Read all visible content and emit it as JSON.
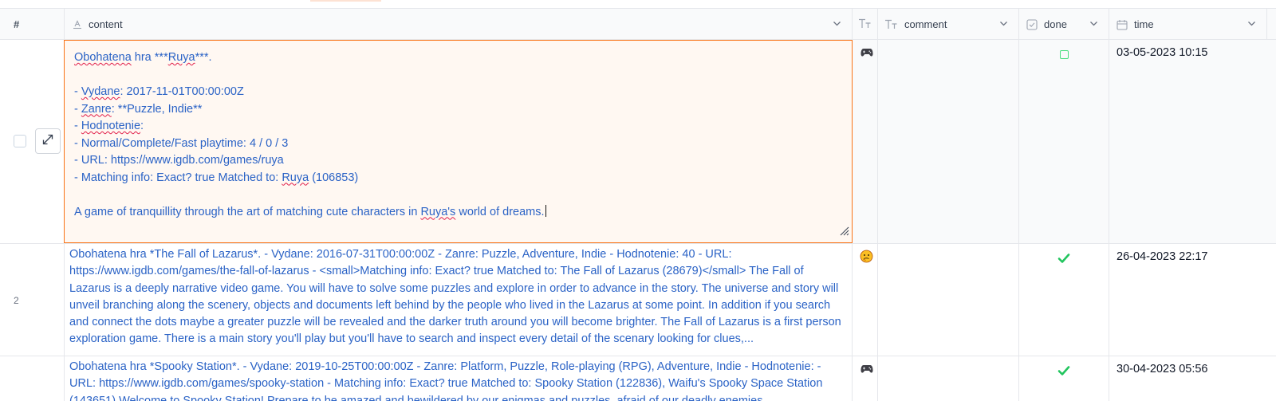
{
  "header": {
    "rownum": "#",
    "content": "content",
    "comment": "comment",
    "done": "done",
    "time": "time"
  },
  "rows": [
    {
      "number": "",
      "editor_lines": [
        "Obohatena hra ***Ruya***.",
        "",
        "- Vydane: 2017-11-01T00:00:00Z",
        "- Zanre: **Puzzle, Indie**",
        "- Hodnotenie:",
        "- Normal/Complete/Fast playtime: 4 / 0 / 3",
        "- URL: https://www.igdb.com/games/ruya",
        "- Matching info: Exact? true Matched to: Ruya (106853)",
        "",
        "A game of tranquillity through the art of matching cute characters in Ruya's world of dreams."
      ],
      "type_icon": "gamepad-icon",
      "comment": "",
      "done": false,
      "time": "03-05-2023 10:15"
    },
    {
      "number": "2",
      "content": "Obohatena hra *The Fall of Lazarus*. - Vydane: 2016-07-31T00:00:00Z - Zanre: Puzzle, Adventure, Indie - Hodnotenie: 40 - URL: https://www.igdb.com/games/the-fall-of-lazarus - <small>Matching info: Exact? true Matched to: The Fall of Lazarus (28679)</small> The Fall of Lazarus is a deeply narrative video game. You will have to solve some puzzles and explore in order to advance in the story. The universe and story will unveil branching along the scenery, objects and documents left behind by the people who lived in the Lazarus at some point. In addition if you search and connect the dots maybe a greater puzzle will be revealed and the darker truth around you will become brighter. The Fall of Lazarus is a first person exploration game. There is a main story you'll play but you'll have to search and inspect every detail of the scenary looking for clues,...",
      "type_icon": "thinking-face-icon",
      "comment": "",
      "done": true,
      "time": "26-04-2023 22:17"
    },
    {
      "number": "",
      "content": "Obohatena hra *Spooky Station*. - Vydane: 2019-10-25T00:00:00Z - Zanre: Platform, Puzzle, Role-playing (RPG), Adventure, Indie - Hodnotenie: - URL: https://www.igdb.com/games/spooky-station - Matching info: Exact? true Matched to: Spooky Station (122836), Waifu's Spooky Space Station (143651) Welcome to Spooky Station! Prepare to be amazed and bewildered by our enigmas and puzzles, afraid of our deadly enemies",
      "type_icon": "gamepad-icon",
      "comment": "",
      "done": true,
      "time": "30-04-2023 05:56"
    }
  ],
  "colors": {
    "link_text": "#2b63c6",
    "editor_border": "#f97316",
    "editor_bg": "#fff8f2",
    "check_green": "#22c55e"
  }
}
